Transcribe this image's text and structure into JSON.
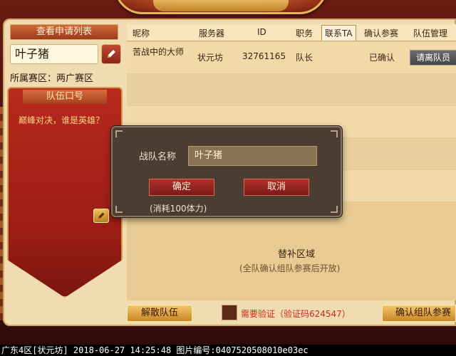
{
  "left": {
    "view_applications": "查看申请列表",
    "team_name": "叶子猪",
    "zone_label": "所属赛区：两广赛区",
    "slogan_title": "队伍口号",
    "slogan_text": "巅峰对决，谁是英雄？"
  },
  "table": {
    "headers": [
      "昵称",
      "服务器",
      "ID",
      "职务",
      "联系TA",
      "确认参赛",
      "队伍管理"
    ],
    "rows": [
      {
        "name": "苦战中的大师",
        "server": "状元坊",
        "id": "32761165",
        "role": "队长",
        "status": "已确认",
        "action": "请离队员"
      }
    ]
  },
  "substitute": {
    "title": "替补区域",
    "note": "(全队确认组队参赛后开放)"
  },
  "bottom": {
    "disband": "解散队伍",
    "verify_text": "需要验证（验证码624547）",
    "confirm_team": "确认组队参赛"
  },
  "modal": {
    "label": "战队名称",
    "input_value": "叶子猪",
    "ok": "确定",
    "cancel": "取消",
    "cost": "(消耗100体力)"
  },
  "status_bar": {
    "text": "广东4区[状元坊] 2018-06-27 14:25:48 图片编号:0407520508010e03ec"
  },
  "icons": [
    "pencil-icon",
    "pencil-icon"
  ]
}
